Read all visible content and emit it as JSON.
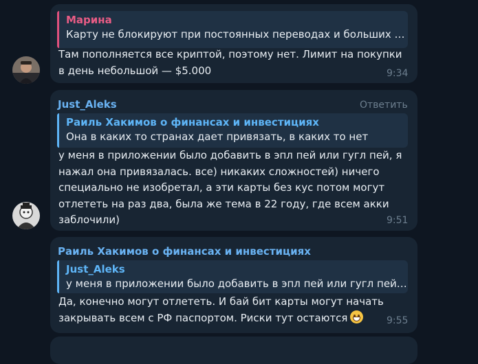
{
  "messages": [
    {
      "reply": {
        "name": "Марина",
        "text": "Карту не блокируют при постоянных переводах и больших с..."
      },
      "text": "Там пополняется все криптой, поэтому нет. Лимит на покупки в день небольшой — $5.000",
      "time": "9:34"
    },
    {
      "sender": "Just_Aleks",
      "action": "Ответить",
      "reply": {
        "name": "Раиль Хакимов о финансах и инвестициях",
        "text": "Она в каких то странах дает привязать, в каких то нет"
      },
      "text": "у меня в приложении было добавить в эпл пей или гугл пей, я нажал она привязалась. все) никаких сложностей) ничего специально не изобретал, а эти карты без кус потом могут отлететь на раз два, была же тема в 22 году, где всем акки заблочили)",
      "time": "9:51"
    },
    {
      "sender": "Раиль Хакимов о финансах и инвестициях",
      "reply": {
        "name": "Just_Aleks",
        "text": "у меня в приложении было добавить в эпл пей или гугл пей,..."
      },
      "text": "Да, конечно могут отлететь. И бай бит карты могут начать закрывать всем с РФ паспортом. Риски тут остаются",
      "emoji": "grinning-face-emoji",
      "time": "9:55"
    }
  ]
}
